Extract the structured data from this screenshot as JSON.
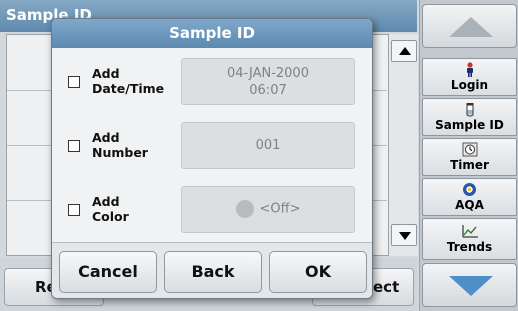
{
  "background": {
    "title": "Sample ID",
    "btn_left_partial": "Re",
    "btn_right_partial": "ect"
  },
  "sidebar": {
    "items": [
      {
        "label": "Login",
        "icon": "person-icon"
      },
      {
        "label": "Sample ID",
        "icon": "vial-icon"
      },
      {
        "label": "Timer",
        "icon": "timer-icon"
      },
      {
        "label": "AQA",
        "icon": "aqa-icon"
      },
      {
        "label": "Trends",
        "icon": "trends-icon"
      }
    ]
  },
  "dialog": {
    "title": "Sample ID",
    "rows": [
      {
        "label_line1": "Add",
        "label_line2": "Date/Time",
        "value_line1": "04-JAN-2000",
        "value_line2": "06:07",
        "checked": false
      },
      {
        "label_line1": "Add",
        "label_line2": "Number",
        "value": "001",
        "checked": false
      },
      {
        "label_line1": "Add",
        "label_line2": "Color",
        "value": "<Off>",
        "checked": false
      }
    ],
    "buttons": {
      "cancel": "Cancel",
      "back": "Back",
      "ok": "OK"
    }
  },
  "colors": {
    "title_bar": "#6e97bc",
    "panel_bg": "#c2c8ce"
  }
}
